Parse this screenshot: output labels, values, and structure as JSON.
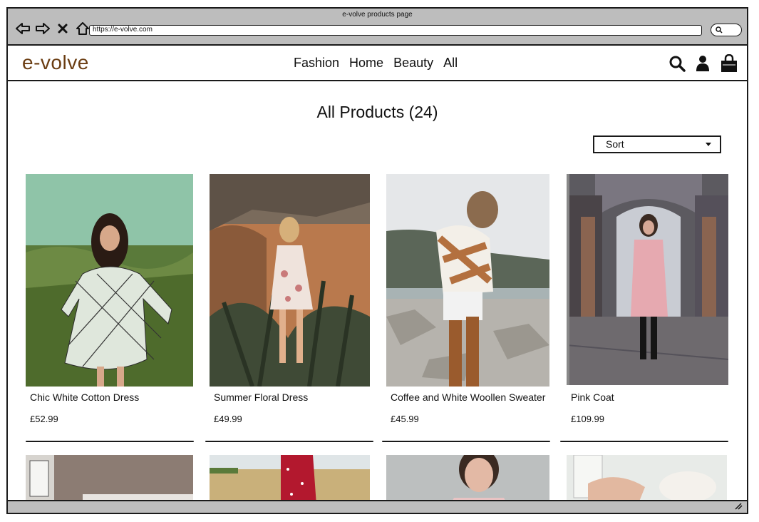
{
  "window": {
    "title": "e-volve products page",
    "url": "https://e-volve.com"
  },
  "header": {
    "logo": "e-volve",
    "menu": [
      "Fashion",
      "Home",
      "Beauty",
      "All"
    ]
  },
  "main": {
    "title": "All Products (24)",
    "sort_label": "Sort"
  },
  "products": [
    {
      "name": "Chic White Cotton Dress",
      "price": "£52.99"
    },
    {
      "name": "Summer Floral Dress",
      "price": "£49.99"
    },
    {
      "name": "Coffee and White Woollen Sweater",
      "price": "£45.99"
    },
    {
      "name": "Pink Coat",
      "price": "£109.99"
    }
  ],
  "colors": {
    "logo": "#6b3d12",
    "frame": "#bdbdbd"
  }
}
